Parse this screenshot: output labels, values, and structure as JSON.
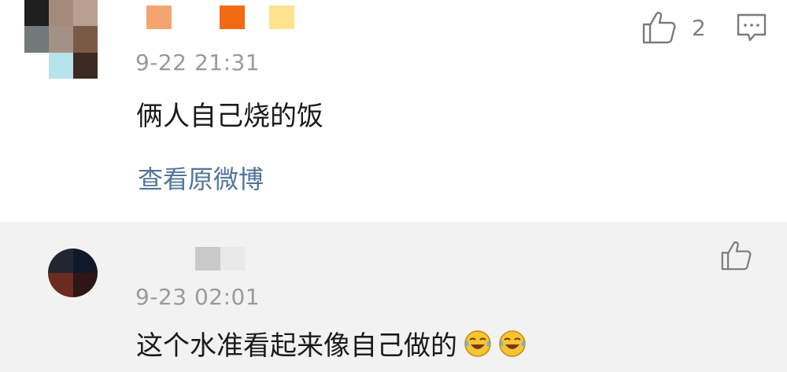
{
  "comments": [
    {
      "timestamp": "9-22 21:31",
      "text": "俩人自己烧的饭",
      "like_count": "2",
      "view_original_label": "查看原微博",
      "avatar_colors": [
        "#1f1f1f",
        "#a38a79",
        "#b7a090",
        "#737878",
        "#a49186",
        "#7b5a45",
        "#ffffff",
        "#b6e3ec",
        "#3b2b21"
      ],
      "name_colors": [
        "#f4a46f",
        "#f26b13",
        "#fbe38f"
      ]
    },
    {
      "timestamp": "9-23 02:01",
      "text": "这个水准看起来像自己做的",
      "avatar_colors": [
        "#222631",
        "#0f1929",
        "#6b2b20",
        "#2d1614"
      ],
      "name_colors": [
        "#c9c9c9",
        "#e9e9e9"
      ],
      "emojis": [
        "laugh-cry-icon",
        "laugh-cry-icon"
      ]
    }
  ],
  "icons": {
    "like": "thumbs-up-icon",
    "reply": "comment-icon"
  },
  "colors": {
    "link": "#53749c",
    "timestamp": "#9a9a9a",
    "reply_bg": "#f2f2f2"
  }
}
